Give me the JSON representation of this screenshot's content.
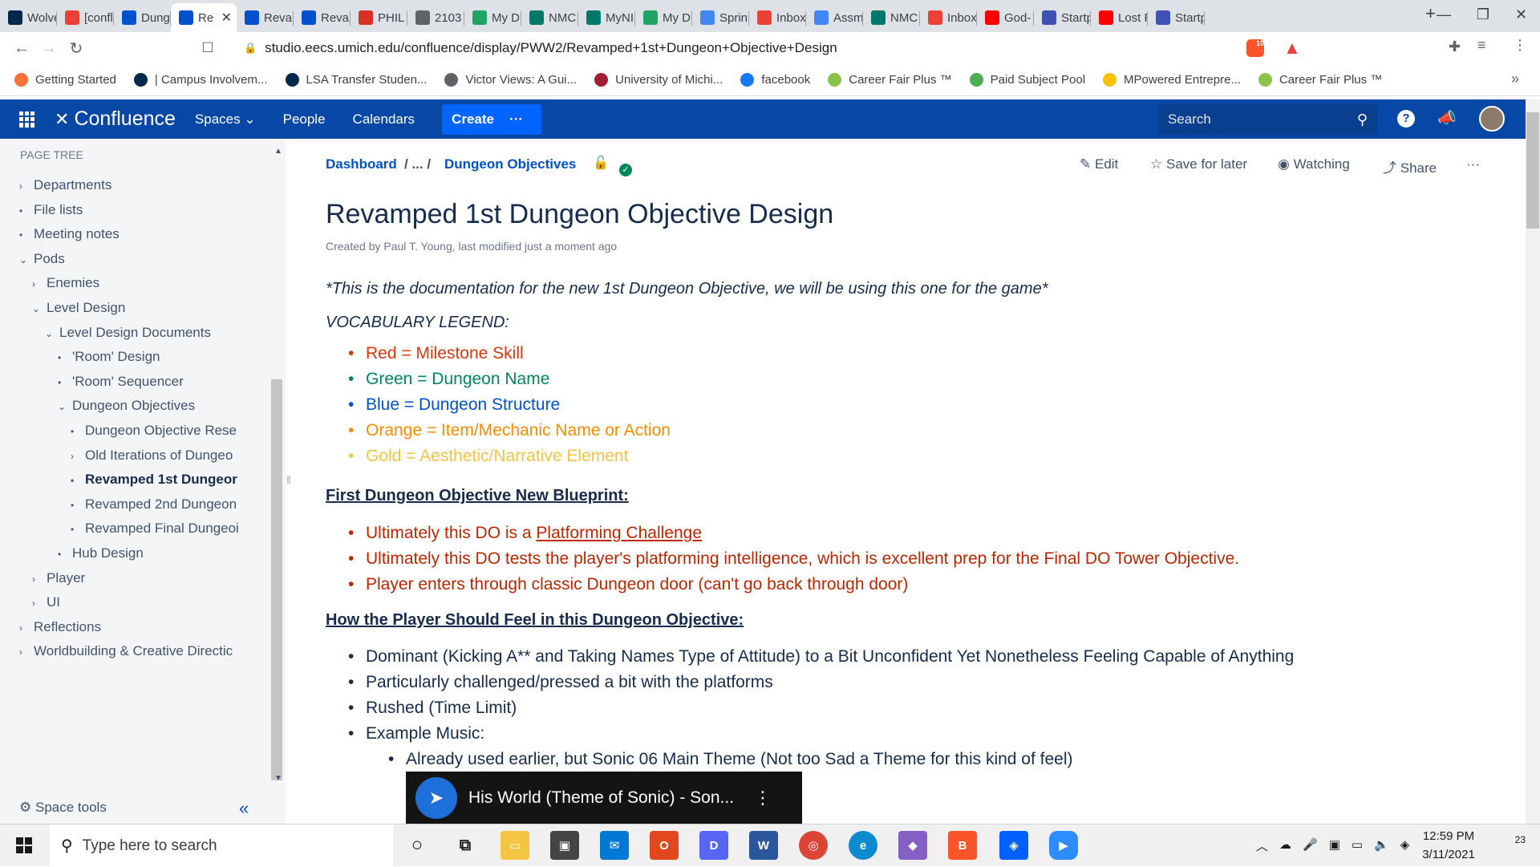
{
  "browser": {
    "tabs": [
      {
        "label": "Wolve",
        "icon": "michigan-icon",
        "color": "#00274c"
      },
      {
        "label": "[confl",
        "icon": "gmail-icon",
        "color": "#ea4335"
      },
      {
        "label": "Dung",
        "icon": "confluence-icon",
        "color": "#0052cc"
      },
      {
        "label": "Re",
        "icon": "confluence-icon",
        "color": "#0052cc",
        "active": true
      },
      {
        "label": "Revan",
        "icon": "confluence-icon",
        "color": "#0052cc"
      },
      {
        "label": "Revan",
        "icon": "confluence-icon",
        "color": "#0052cc"
      },
      {
        "label": "PHIL",
        "icon": "phil-icon",
        "color": "#d93025"
      },
      {
        "label": "2103",
        "icon": "globe-icon",
        "color": "#5f6368"
      },
      {
        "label": "My D",
        "icon": "drive-icon",
        "color": "#1fa463"
      },
      {
        "label": "NMC",
        "icon": "bookmark-icon",
        "color": "#00796b"
      },
      {
        "label": "MyNI",
        "icon": "bookmark-icon",
        "color": "#00796b"
      },
      {
        "label": "My D",
        "icon": "drive-icon",
        "color": "#1fa463"
      },
      {
        "label": "Sprin",
        "icon": "docs-icon",
        "color": "#4285f4"
      },
      {
        "label": "Inbox",
        "icon": "gmail-icon",
        "color": "#ea4335"
      },
      {
        "label": "Assm",
        "icon": "docs-icon",
        "color": "#4285f4"
      },
      {
        "label": "NMC",
        "icon": "bookmark-icon",
        "color": "#00796b"
      },
      {
        "label": "Inbox",
        "icon": "gmail-icon",
        "color": "#ea4335"
      },
      {
        "label": "God-",
        "icon": "youtube-icon",
        "color": "#ff0000"
      },
      {
        "label": "Startp",
        "icon": "startpage-icon",
        "color": "#3f51b5"
      },
      {
        "label": "Lost F",
        "icon": "youtube-icon",
        "color": "#ff0000"
      },
      {
        "label": "Startp",
        "icon": "startpage-icon",
        "color": "#3f51b5"
      }
    ],
    "new_tab": "+",
    "url": "studio.eecs.umich.edu/confluence/display/PWW2/Revamped+1st+Dungeon+Objective+Design",
    "brave_badge": "10",
    "bookmarks": [
      {
        "label": "Getting Started",
        "icon": "firefox-icon",
        "color": "#ff7139"
      },
      {
        "label": "| Campus Involvem...",
        "icon": "michigan-icon",
        "color": "#00274c"
      },
      {
        "label": "LSA Transfer Studen...",
        "icon": "lsa-icon",
        "color": "#00274c"
      },
      {
        "label": "Victor Views: A Gui...",
        "icon": "globe-icon",
        "color": "#5f6368"
      },
      {
        "label": "University of Michi...",
        "icon": "um-icon",
        "color": "#a51c30"
      },
      {
        "label": "facebook",
        "icon": "facebook-icon",
        "color": "#1877f2"
      },
      {
        "label": "Career Fair Plus ™",
        "icon": "careerfair-icon",
        "color": "#8bc34a"
      },
      {
        "label": "Paid Subject Pool",
        "icon": "pool-icon",
        "color": "#4caf50"
      },
      {
        "label": "MPowered Entrepre...",
        "icon": "hexagon-icon",
        "color": "#ffc107"
      },
      {
        "label": "Career Fair Plus ™",
        "icon": "careerfair-icon",
        "color": "#8bc34a"
      }
    ]
  },
  "header": {
    "brand": "Confluence",
    "spaces": "Spaces",
    "people": "People",
    "calendars": "Calendars",
    "create": "Create",
    "more": "···",
    "search_placeholder": "Search",
    "help": "?"
  },
  "sidebar": {
    "title": "PAGE TREE",
    "items": [
      {
        "label": "Departments",
        "mark": "›",
        "depth": 0
      },
      {
        "label": "File lists",
        "mark": "•",
        "depth": 0
      },
      {
        "label": "Meeting notes",
        "mark": "•",
        "depth": 0
      },
      {
        "label": "Pods",
        "mark": "⌄",
        "depth": 0
      },
      {
        "label": "Enemies",
        "mark": "›",
        "depth": 1
      },
      {
        "label": "Level Design",
        "mark": "⌄",
        "depth": 1
      },
      {
        "label": "Level Design Documents",
        "mark": "⌄",
        "depth": 2
      },
      {
        "label": "'Room' Design",
        "mark": "•",
        "depth": 3
      },
      {
        "label": "'Room' Sequencer",
        "mark": "•",
        "depth": 3
      },
      {
        "label": "Dungeon Objectives",
        "mark": "⌄",
        "depth": 3
      },
      {
        "label": "Dungeon Objective Rese",
        "mark": "•",
        "depth": 4
      },
      {
        "label": "Old Iterations of Dungeo",
        "mark": "›",
        "depth": 4
      },
      {
        "label": "Revamped 1st Dungeor",
        "mark": "•",
        "depth": 4,
        "bold": true
      },
      {
        "label": "Revamped 2nd Dungeon",
        "mark": "•",
        "depth": 4
      },
      {
        "label": "Revamped Final Dungeoi",
        "mark": "•",
        "depth": 4
      },
      {
        "label": "Hub Design",
        "mark": "•",
        "depth": 3
      },
      {
        "label": "Player",
        "mark": "›",
        "depth": 1
      },
      {
        "label": "UI",
        "mark": "›",
        "depth": 1
      },
      {
        "label": "Reflections",
        "mark": "›",
        "depth": 0
      },
      {
        "label": "Worldbuilding & Creative Directic",
        "mark": "›",
        "depth": 0
      }
    ],
    "space_tools": "Space tools",
    "collapse": "«"
  },
  "page": {
    "breadcrumb": {
      "dashboard": "Dashboard",
      "sep": "/ ... /",
      "current": "Dungeon Objectives"
    },
    "actions": {
      "edit": "Edit",
      "save": "Save for later",
      "watch": "Watching",
      "share": "Share",
      "more": "···"
    },
    "title": "Revamped 1st Dungeon Objective Design",
    "meta": "Created by Paul T. Young, last modified just a moment ago",
    "intro": "*This is the documentation for the new 1st Dungeon Objective, we will be using this one for the game*",
    "legend_title": "VOCABULARY LEGEND:",
    "legend": [
      {
        "text": "Red = Milestone Skill",
        "color": "#de350b"
      },
      {
        "text": "Green = Dungeon Name",
        "color": "#00875a"
      },
      {
        "text": "Blue = Dungeon Structure",
        "color": "#0052cc"
      },
      {
        "text": "Orange = Item/Mechanic Name or Action",
        "color": "#ff8b00"
      },
      {
        "text": "Gold = Aesthetic/Narrative Element",
        "color": "#f6c342"
      }
    ],
    "blueprint_title": "First Dungeon Objective New Blueprint:",
    "blueprint": {
      "item1_pre": "Ultimately this DO is a ",
      "item1_link": "Platforming Challenge",
      "item2": "Ultimately this DO tests the player's platforming intelligence, which is excellent prep for the Final DO Tower Objective.",
      "item3": "Player enters through classic Dungeon door (can't go back through door)",
      "color": "#bf2600"
    },
    "feel_title": "How the Player Should Feel in this Dungeon Objective:",
    "feel": [
      "Dominant (Kicking A** and Taking Names Type of Attitude) to a Bit Unconfident Yet Nonetheless Feeling Capable of Anything",
      "Particularly challenged/pressed a bit with the platforms",
      "Rushed (Time Limit)",
      "Example Music:"
    ],
    "feel_sub": "Already used earlier, but Sonic 06 Main Theme (Not too Sad a Theme for this kind of feel)",
    "video_title": "His World (Theme of Sonic) - Son..."
  },
  "taskbar": {
    "search": "Type here to search",
    "time": "12:59 PM",
    "date": "3/11/2021",
    "notif": "23"
  }
}
